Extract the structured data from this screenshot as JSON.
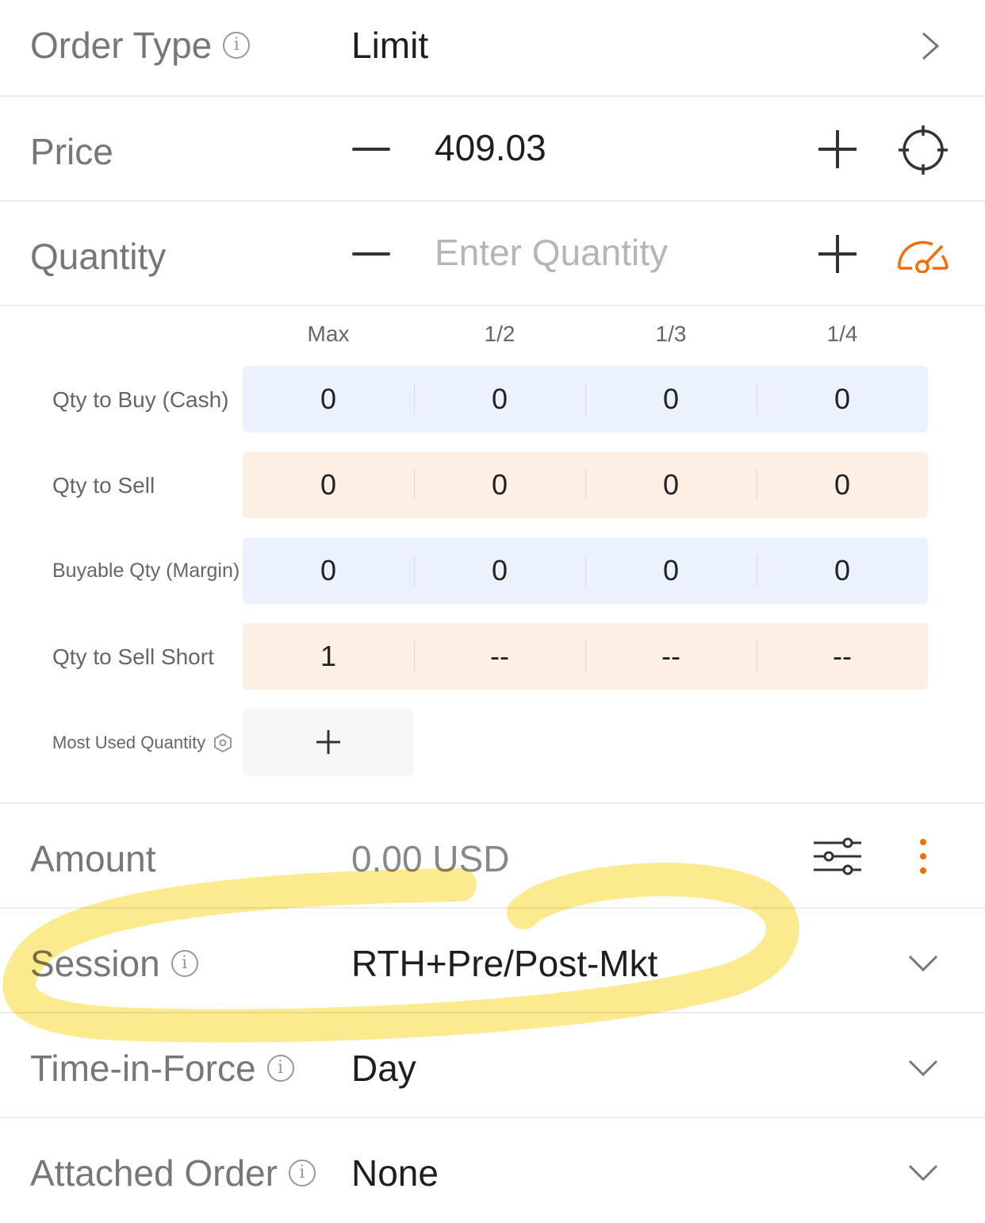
{
  "order_type": {
    "label": "Order Type",
    "value": "Limit"
  },
  "price": {
    "label": "Price",
    "value": "409.03"
  },
  "quantity": {
    "label": "Quantity",
    "placeholder": "Enter Quantity"
  },
  "qty_table": {
    "headers": [
      "Max",
      "1/2",
      "1/3",
      "1/4"
    ],
    "rows": [
      {
        "label": "Qty to Buy (Cash)",
        "values": [
          "0",
          "0",
          "0",
          "0"
        ],
        "tone": "blue"
      },
      {
        "label": "Qty to Sell",
        "values": [
          "0",
          "0",
          "0",
          "0"
        ],
        "tone": "peach"
      },
      {
        "label": "Buyable Qty (Margin)",
        "values": [
          "0",
          "0",
          "0",
          "0"
        ],
        "tone": "blue"
      },
      {
        "label": "Qty to Sell Short",
        "values": [
          "1",
          "--",
          "--",
          "--"
        ],
        "tone": "peach"
      }
    ],
    "most_used_label": "Most Used Quantity",
    "add_symbol": "+"
  },
  "amount": {
    "label": "Amount",
    "value": "0.00 USD"
  },
  "session": {
    "label": "Session",
    "value": "RTH+Pre/Post-Mkt"
  },
  "time_in_force": {
    "label": "Time-in-Force",
    "value": "Day"
  },
  "attached_order": {
    "label": "Attached Order",
    "value": "None"
  },
  "colors": {
    "accent": "#ff6a00",
    "highlight": "#fbe36a",
    "buy_bg": "#ebf2fe",
    "sell_bg": "#fdefe4"
  }
}
